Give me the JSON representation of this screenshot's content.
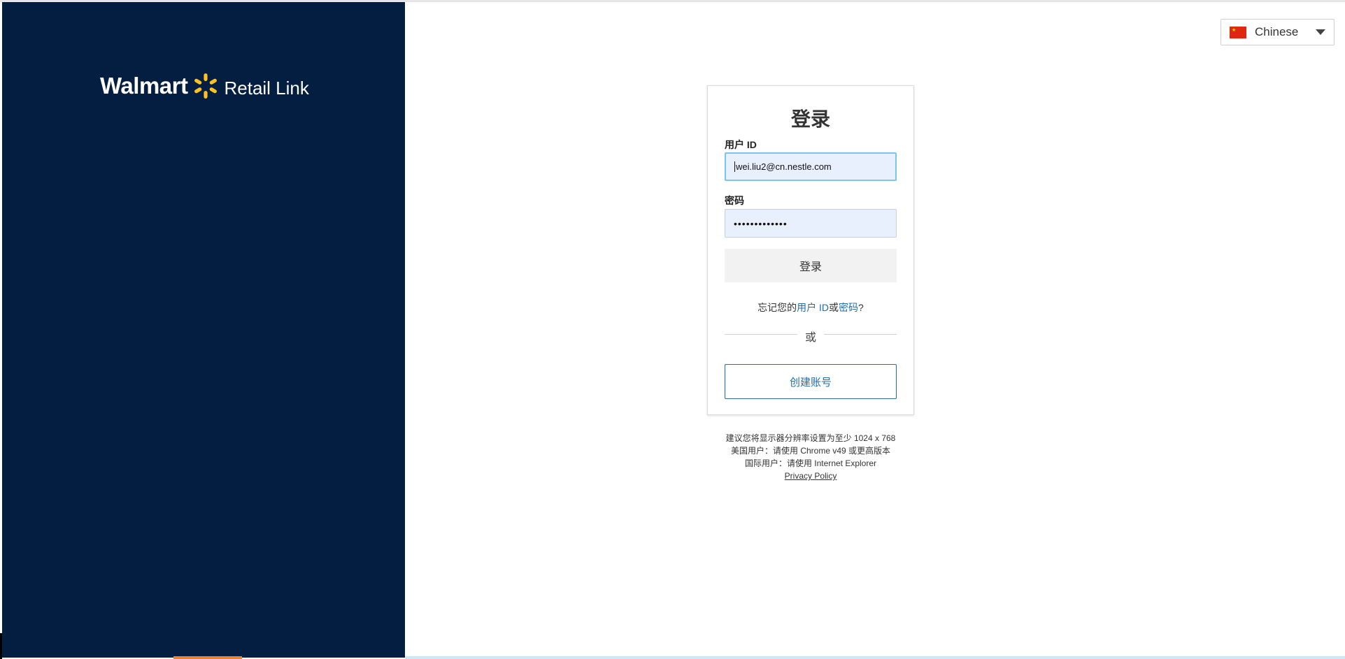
{
  "brand": {
    "name": "Walmart",
    "product": "Retail Link",
    "accent_color": "#ffc220",
    "sidebar_color": "#041e42"
  },
  "language_selector": {
    "flag_icon": "china-flag-icon",
    "selected": "Chinese"
  },
  "login_form": {
    "title": "登录",
    "user_id_label": "用户 ID",
    "user_id_value": "wei.liu2@cn.nestle.com",
    "password_label": "密码",
    "password_value_masked": "•••••••••••••",
    "login_button": "登录",
    "forgot_prefix": "忘记您的",
    "forgot_user_id_link": "用户 ID",
    "forgot_or": "或",
    "forgot_password_link": "密码",
    "forgot_suffix": "?",
    "divider_text": "或",
    "create_account_button": "创建账号",
    "link_color": "#1f6dab"
  },
  "notes": {
    "line1": "建议您将显示器分辨率设置为至少 1024 x 768",
    "line2": "美国用户：请使用 Chrome v49 或更高版本",
    "line3": "国际用户：请使用 Internet Explorer",
    "privacy_link": "Privacy Policy"
  }
}
